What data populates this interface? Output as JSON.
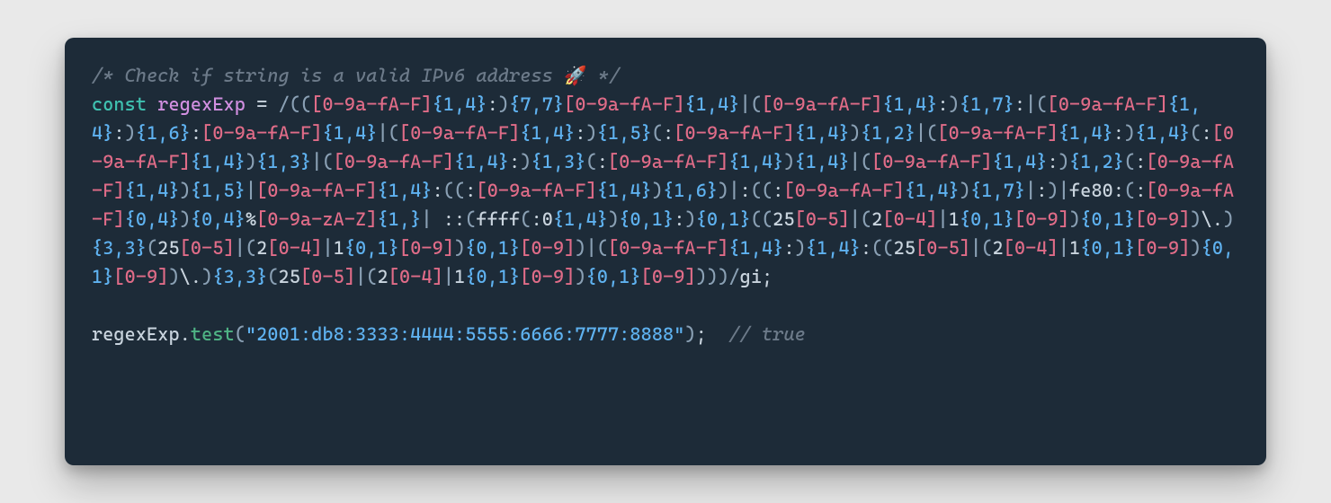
{
  "comment_prefix": "/* ",
  "comment_text": "Check if string is a valid IPv6 address ",
  "emoji": "🚀",
  "comment_suffix": "*/",
  "const_kw": "const",
  "var_name": "regexExp",
  "equals": "=",
  "regex_open": "/",
  "regex_tokens": [
    {
      "t": "delim",
      "v": "(("
    },
    {
      "t": "cc",
      "v": "[0-9a-fA-F]"
    },
    {
      "t": "q",
      "v": "{1,4}"
    },
    {
      "t": "plain",
      "v": ":"
    },
    {
      "t": "delim",
      "v": ")"
    },
    {
      "t": "q",
      "v": "{7,7}"
    },
    {
      "t": "cc",
      "v": "[0-9a-fA-F]"
    },
    {
      "t": "q",
      "v": "{1,4}"
    },
    {
      "t": "delim",
      "v": "|"
    },
    {
      "t": "delim",
      "v": "("
    },
    {
      "t": "cc",
      "v": "[0-9a-fA-F]"
    },
    {
      "t": "q",
      "v": "{1,4}"
    },
    {
      "t": "plain",
      "v": ":"
    },
    {
      "t": "delim",
      "v": ")"
    },
    {
      "t": "q",
      "v": "{1,7}"
    },
    {
      "t": "plain",
      "v": ":"
    },
    {
      "t": "delim",
      "v": "|"
    },
    {
      "t": "delim",
      "v": "("
    },
    {
      "t": "cc",
      "v": "[0-9a-fA-F]"
    },
    {
      "t": "q",
      "v": "{1,4}"
    },
    {
      "t": "plain",
      "v": ":"
    },
    {
      "t": "delim",
      "v": ")"
    },
    {
      "t": "q",
      "v": "{1,6}"
    },
    {
      "t": "plain",
      "v": ":"
    },
    {
      "t": "cc",
      "v": "[0-9a-fA-F]"
    },
    {
      "t": "q",
      "v": "{1,4}"
    },
    {
      "t": "delim",
      "v": "|"
    },
    {
      "t": "delim",
      "v": "("
    },
    {
      "t": "cc",
      "v": "[0-9a-fA-F]"
    },
    {
      "t": "q",
      "v": "{1,4}"
    },
    {
      "t": "plain",
      "v": ":"
    },
    {
      "t": "delim",
      "v": ")"
    },
    {
      "t": "q",
      "v": "{1,5}"
    },
    {
      "t": "delim",
      "v": "("
    },
    {
      "t": "plain",
      "v": ":"
    },
    {
      "t": "cc",
      "v": "[0-9a-fA-F]"
    },
    {
      "t": "q",
      "v": "{1,4}"
    },
    {
      "t": "delim",
      "v": ")"
    },
    {
      "t": "q",
      "v": "{1,2}"
    },
    {
      "t": "delim",
      "v": "|"
    },
    {
      "t": "delim",
      "v": "("
    },
    {
      "t": "cc",
      "v": "[0-9a-fA-F]"
    },
    {
      "t": "q",
      "v": "{1,4}"
    },
    {
      "t": "plain",
      "v": ":"
    },
    {
      "t": "delim",
      "v": ")"
    },
    {
      "t": "q",
      "v": "{1,4}"
    },
    {
      "t": "delim",
      "v": "("
    },
    {
      "t": "plain",
      "v": ":"
    },
    {
      "t": "cc",
      "v": "[0-9a-fA-F]"
    },
    {
      "t": "q",
      "v": "{1,4}"
    },
    {
      "t": "delim",
      "v": ")"
    },
    {
      "t": "q",
      "v": "{1,3}"
    },
    {
      "t": "delim",
      "v": "|"
    },
    {
      "t": "delim",
      "v": "("
    },
    {
      "t": "cc",
      "v": "[0-9a-fA-F]"
    },
    {
      "t": "q",
      "v": "{1,4}"
    },
    {
      "t": "plain",
      "v": ":"
    },
    {
      "t": "delim",
      "v": ")"
    },
    {
      "t": "q",
      "v": "{1,3}"
    },
    {
      "t": "delim",
      "v": "("
    },
    {
      "t": "plain",
      "v": ":"
    },
    {
      "t": "cc",
      "v": "[0-9a-fA-F]"
    },
    {
      "t": "q",
      "v": "{1,4}"
    },
    {
      "t": "delim",
      "v": ")"
    },
    {
      "t": "q",
      "v": "{1,4}"
    },
    {
      "t": "delim",
      "v": "|"
    },
    {
      "t": "delim",
      "v": "("
    },
    {
      "t": "cc",
      "v": "[0-9a-fA-F]"
    },
    {
      "t": "q",
      "v": "{1,4}"
    },
    {
      "t": "plain",
      "v": ":"
    },
    {
      "t": "delim",
      "v": ")"
    },
    {
      "t": "q",
      "v": "{1,2}"
    },
    {
      "t": "delim",
      "v": "("
    },
    {
      "t": "plain",
      "v": ":"
    },
    {
      "t": "cc",
      "v": "[0-9a-fA-F]"
    },
    {
      "t": "q",
      "v": "{1,4}"
    },
    {
      "t": "delim",
      "v": ")"
    },
    {
      "t": "q",
      "v": "{1,5}"
    },
    {
      "t": "delim",
      "v": "|"
    },
    {
      "t": "cc",
      "v": "[0-9a-fA-F]"
    },
    {
      "t": "q",
      "v": "{1,4}"
    },
    {
      "t": "plain",
      "v": ":"
    },
    {
      "t": "delim",
      "v": "(("
    },
    {
      "t": "plain",
      "v": ":"
    },
    {
      "t": "cc",
      "v": "[0-9a-fA-F]"
    },
    {
      "t": "q",
      "v": "{1,4}"
    },
    {
      "t": "delim",
      "v": ")"
    },
    {
      "t": "q",
      "v": "{1,6}"
    },
    {
      "t": "delim",
      "v": ")|"
    },
    {
      "t": "plain",
      "v": ":"
    },
    {
      "t": "delim",
      "v": "(("
    },
    {
      "t": "plain",
      "v": ":"
    },
    {
      "t": "cc",
      "v": "[0-9a-fA-F]"
    },
    {
      "t": "q",
      "v": "{1,4}"
    },
    {
      "t": "delim",
      "v": ")"
    },
    {
      "t": "q",
      "v": "{1,7}"
    },
    {
      "t": "delim",
      "v": "|"
    },
    {
      "t": "plain",
      "v": ":"
    },
    {
      "t": "delim",
      "v": ")|"
    },
    {
      "t": "plain",
      "v": "fe80:"
    },
    {
      "t": "delim",
      "v": "("
    },
    {
      "t": "plain",
      "v": ":"
    },
    {
      "t": "cc",
      "v": "[0-9a-fA-F]"
    },
    {
      "t": "q",
      "v": "{0,4}"
    },
    {
      "t": "delim",
      "v": ")"
    },
    {
      "t": "q",
      "v": "{0,4}"
    },
    {
      "t": "plain",
      "v": "%"
    },
    {
      "t": "cc",
      "v": "[0-9a-zA-Z]"
    },
    {
      "t": "q",
      "v": "{1,}"
    },
    {
      "t": "delim",
      "v": "|"
    },
    {
      "t": "plain",
      "v": " ::"
    },
    {
      "t": "delim",
      "v": "("
    },
    {
      "t": "plain",
      "v": "ffff"
    },
    {
      "t": "delim",
      "v": "("
    },
    {
      "t": "plain",
      "v": ":0"
    },
    {
      "t": "q",
      "v": "{1,4}"
    },
    {
      "t": "delim",
      "v": ")"
    },
    {
      "t": "q",
      "v": "{0,1}"
    },
    {
      "t": "plain",
      "v": ":"
    },
    {
      "t": "delim",
      "v": ")"
    },
    {
      "t": "q",
      "v": "{0,1}"
    },
    {
      "t": "delim",
      "v": "(("
    },
    {
      "t": "plain",
      "v": "25"
    },
    {
      "t": "cc",
      "v": "[0-5]"
    },
    {
      "t": "delim",
      "v": "|"
    },
    {
      "t": "delim",
      "v": "("
    },
    {
      "t": "plain",
      "v": "2"
    },
    {
      "t": "cc",
      "v": "[0-4]"
    },
    {
      "t": "delim",
      "v": "|"
    },
    {
      "t": "plain",
      "v": "1"
    },
    {
      "t": "q",
      "v": "{0,1}"
    },
    {
      "t": "cc",
      "v": "[0-9]"
    },
    {
      "t": "delim",
      "v": ")"
    },
    {
      "t": "q",
      "v": "{0,1}"
    },
    {
      "t": "cc",
      "v": "[0-9]"
    },
    {
      "t": "delim",
      "v": ")"
    },
    {
      "t": "plain",
      "v": "\\."
    },
    {
      "t": "delim",
      "v": ")"
    },
    {
      "t": "q",
      "v": "{3,3}"
    },
    {
      "t": "delim",
      "v": "("
    },
    {
      "t": "plain",
      "v": "25"
    },
    {
      "t": "cc",
      "v": "[0-5]"
    },
    {
      "t": "delim",
      "v": "|"
    },
    {
      "t": "delim",
      "v": "("
    },
    {
      "t": "plain",
      "v": "2"
    },
    {
      "t": "cc",
      "v": "[0-4]"
    },
    {
      "t": "delim",
      "v": "|"
    },
    {
      "t": "plain",
      "v": "1"
    },
    {
      "t": "q",
      "v": "{0,1}"
    },
    {
      "t": "cc",
      "v": "[0-9]"
    },
    {
      "t": "delim",
      "v": ")"
    },
    {
      "t": "q",
      "v": "{0,1}"
    },
    {
      "t": "cc",
      "v": "[0-9]"
    },
    {
      "t": "delim",
      "v": ")|"
    },
    {
      "t": "delim",
      "v": "("
    },
    {
      "t": "cc",
      "v": "[0-9a-fA-F]"
    },
    {
      "t": "q",
      "v": "{1,4}"
    },
    {
      "t": "plain",
      "v": ":"
    },
    {
      "t": "delim",
      "v": ")"
    },
    {
      "t": "q",
      "v": "{1,4}"
    },
    {
      "t": "plain",
      "v": ":"
    },
    {
      "t": "delim",
      "v": "(("
    },
    {
      "t": "plain",
      "v": "25"
    },
    {
      "t": "cc",
      "v": "[0-5]"
    },
    {
      "t": "delim",
      "v": "|"
    },
    {
      "t": "delim",
      "v": "("
    },
    {
      "t": "plain",
      "v": "2"
    },
    {
      "t": "cc",
      "v": "[0-4]"
    },
    {
      "t": "delim",
      "v": "|"
    },
    {
      "t": "plain",
      "v": "1"
    },
    {
      "t": "q",
      "v": "{0,1}"
    },
    {
      "t": "cc",
      "v": "[0-9]"
    },
    {
      "t": "delim",
      "v": ")"
    },
    {
      "t": "q",
      "v": "{0,1}"
    },
    {
      "t": "cc",
      "v": "[0-9]"
    },
    {
      "t": "delim",
      "v": ")"
    },
    {
      "t": "plain",
      "v": "\\."
    },
    {
      "t": "delim",
      "v": ")"
    },
    {
      "t": "q",
      "v": "{3,3}"
    },
    {
      "t": "delim",
      "v": "("
    },
    {
      "t": "plain",
      "v": "25"
    },
    {
      "t": "cc",
      "v": "[0-5]"
    },
    {
      "t": "delim",
      "v": "|"
    },
    {
      "t": "delim",
      "v": "("
    },
    {
      "t": "plain",
      "v": "2"
    },
    {
      "t": "cc",
      "v": "[0-4]"
    },
    {
      "t": "delim",
      "v": "|"
    },
    {
      "t": "plain",
      "v": "1"
    },
    {
      "t": "q",
      "v": "{0,1}"
    },
    {
      "t": "cc",
      "v": "[0-9]"
    },
    {
      "t": "delim",
      "v": ")"
    },
    {
      "t": "q",
      "v": "{0,1}"
    },
    {
      "t": "cc",
      "v": "[0-9]"
    },
    {
      "t": "delim",
      "v": ")))"
    }
  ],
  "regex_close": "/",
  "regex_flags": "gi",
  "semicolon": ";",
  "call_obj": "regexExp",
  "call_dot": ".",
  "call_method": "test",
  "call_open": "(",
  "call_arg": "\"2001:db8:3333:4444:5555:6666:7777:8888\"",
  "call_close": ")",
  "call_semicolon": ";",
  "trailing_comment": "// true"
}
